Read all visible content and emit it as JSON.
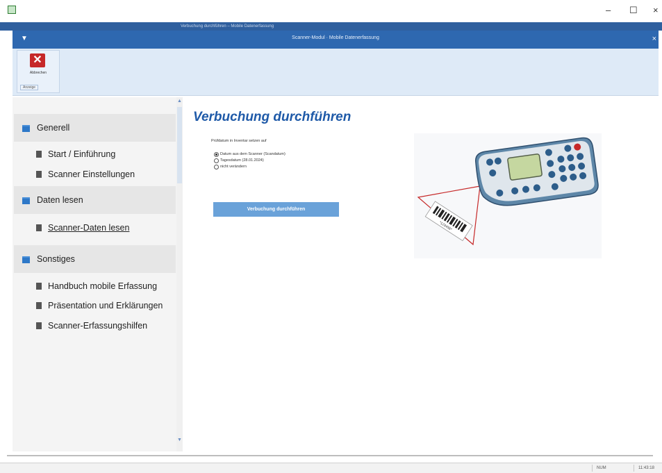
{
  "outer_window": {
    "title": "Verbuchung durchführen – Mobile Datenerfassung",
    "controls": {
      "minimize": "–",
      "maximize": "☐",
      "close": "×"
    }
  },
  "dialog": {
    "title": "Scanner-Modul · Mobile Datenerfassung",
    "menu_glyph": "▼",
    "close_glyph": "×"
  },
  "ribbon": {
    "abort_button": {
      "label": "Abbrechen",
      "icon": "close-icon",
      "glyph": "✕"
    },
    "group_label": "Anzeige"
  },
  "nav": {
    "groups": [
      {
        "label": "Generell",
        "icon": "folder-icon"
      },
      {
        "label": "Daten lesen",
        "icon": "folder-icon"
      },
      {
        "label": "Sonstiges",
        "icon": "folder-icon"
      }
    ],
    "items": [
      {
        "label": "Start / Einführung"
      },
      {
        "label": "Scanner Einstellungen"
      },
      {
        "label": "Scanner-Daten lesen"
      },
      {
        "label": "Handbuch mobile Erfassung"
      },
      {
        "label": "Präsentation und Erklärungen"
      },
      {
        "label": "Scanner-Erfassungshilfen"
      }
    ],
    "scroll_up": "▲",
    "scroll_down": "▼"
  },
  "content": {
    "heading": "Verbuchung durchführen",
    "options_label": "Prüfdatum in Inventar setzen auf",
    "radio_options": [
      {
        "label": "Datum aus dem Scanner (Scandatum)",
        "selected": true
      },
      {
        "label": "Tagesdatum (28.01.2024)",
        "selected": false
      },
      {
        "label": "nicht verändern",
        "selected": false
      }
    ],
    "book_button": "Verbuchung durchführen",
    "barcode_text": "*123456*"
  },
  "status_bar": {
    "mode": "NUM",
    "time": "11:43:18"
  },
  "colors": {
    "title_blue": "#2e68b0",
    "accent_blue": "#1f5aa8",
    "button_blue": "#6aa2d9",
    "abort_red": "#c62828"
  }
}
